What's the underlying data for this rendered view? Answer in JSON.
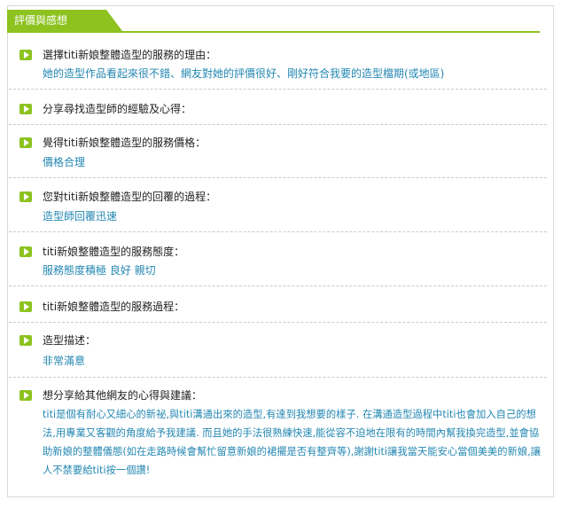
{
  "section_title": "評價與感想",
  "items": [
    {
      "question": "選擇titi新娘整體造型的服務的理由：",
      "answer": "她的造型作品看起來很不錯、網友對她的評價很好、剛好符合我要的造型檔期(或地區)"
    },
    {
      "question": "分享尋找造型師的經驗及心得：",
      "answer": ""
    },
    {
      "question": "覺得titi新娘整體造型的服務價格：",
      "answer": "價格合理"
    },
    {
      "question": "您對titi新娘整體造型的回覆的過程：",
      "answer": "造型師回覆迅速"
    },
    {
      "question": "titi新娘整體造型的服務態度：",
      "answer": "服務態度積極 良好 親切"
    },
    {
      "question": "titi新娘整體造型的服務過程：",
      "answer": ""
    },
    {
      "question": "造型描述：",
      "answer": "非常滿意"
    },
    {
      "question": "想分享給其他網友的心得與建議：",
      "answer": "titi是個有耐心又細心的新祕,與titi溝通出來的造型,有達到我想要的樣子. 在溝通造型過程中titi也會加入自己的想法,用專業又客觀的角度給予我建議. 而且她的手法很熟練快速,能從容不迫地在限有的時間內幫我換完造型,並會協助新娘的整體儀態(如在走路時候會幫忙留意新娘的裙擺是否有整齊等),謝謝titi讓我當天能安心當個美美的新娘,讓人不禁要給titi按一個讚!"
    }
  ],
  "colors": {
    "accent": "#8dc21f",
    "answer": "#2387b2",
    "divider": "#c9c9c9"
  }
}
